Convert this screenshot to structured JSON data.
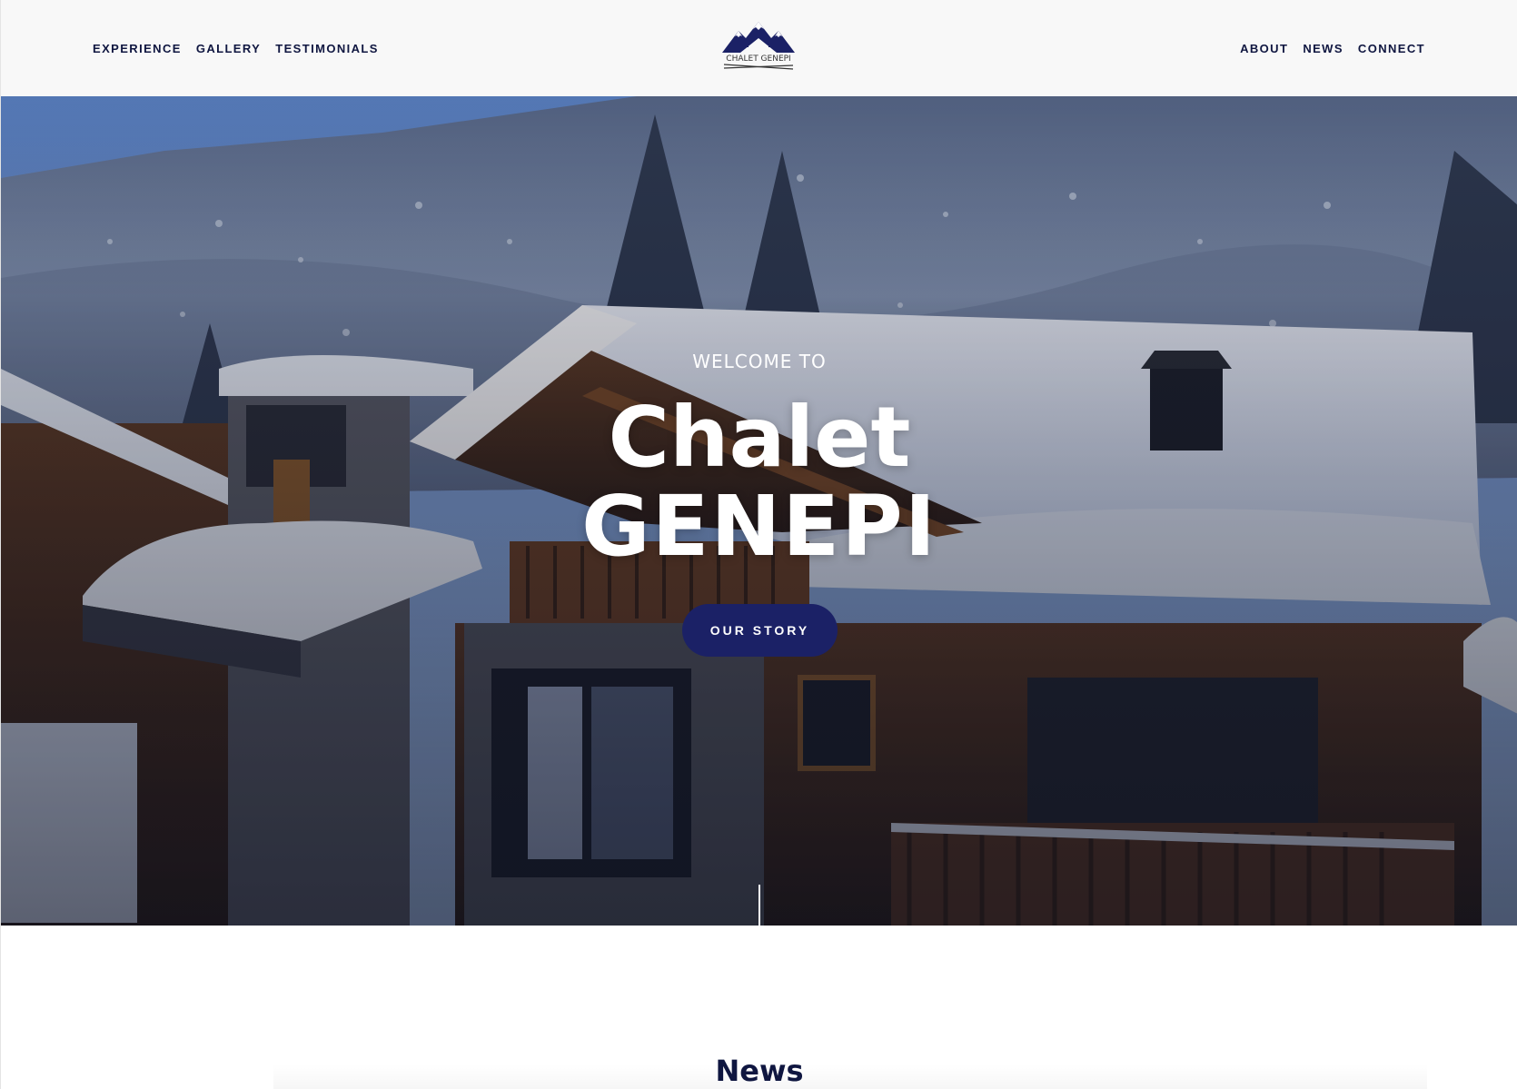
{
  "header": {
    "left_nav": [
      {
        "label": "EXPERIENCE"
      },
      {
        "label": "GALLERY"
      },
      {
        "label": "TESTIMONIALS"
      }
    ],
    "right_nav": [
      {
        "label": "ABOUT"
      },
      {
        "label": "NEWS"
      },
      {
        "label": "CONNECT"
      }
    ],
    "logo_text": "CHALET GENEPI"
  },
  "hero": {
    "welcome": "WELCOME TO",
    "title_line1": "Chalet",
    "title_line2": "GENEPI",
    "button_label": "OUR STORY"
  },
  "news": {
    "heading": "News"
  },
  "colors": {
    "navy": "#1b2166",
    "nav_text": "#0f1640",
    "header_bg": "#f8f8f8"
  }
}
